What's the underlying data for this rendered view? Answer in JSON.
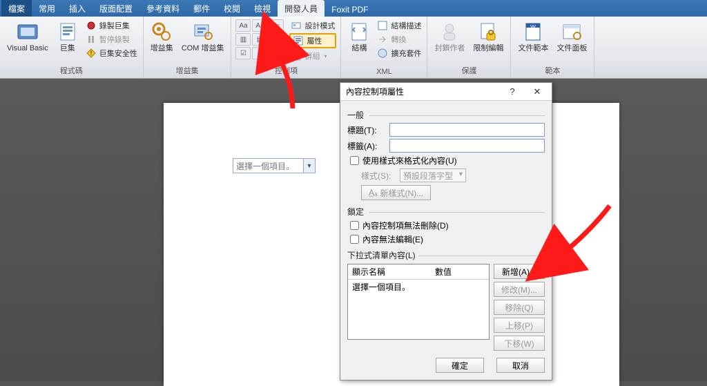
{
  "tabs": {
    "file": "檔案",
    "home": "常用",
    "insert": "插入",
    "layout": "版面配置",
    "references": "參考資料",
    "mailings": "郵件",
    "review": "校閱",
    "view": "檢視",
    "developer": "開發人員",
    "foxit": "Foxit PDF"
  },
  "ribbon": {
    "code_group": {
      "vb": "Visual Basic",
      "macros": "巨集",
      "record": "錄製巨集",
      "pause": "暫停錄製",
      "security": "巨集安全性",
      "caption": "程式碼"
    },
    "addins_group": {
      "addins": "增益集",
      "com": "COM 增益集",
      "caption": "增益集"
    },
    "controls_group": {
      "design_mode": "設計模式",
      "properties": "屬性",
      "group": "群組",
      "caption": "控制項"
    },
    "xml_group": {
      "structure": "結構",
      "schema_desc": "結構描述",
      "transform": "轉換",
      "expansion": "擴充套件",
      "caption": "XML"
    },
    "protect_group": {
      "block_author": "封鎖作者",
      "restrict_edit": "限制編輯",
      "caption": "保護"
    },
    "templates_group": {
      "doc_template": "文件範本",
      "doc_panel": "文件面板",
      "caption": "範本"
    }
  },
  "doc_ctrl": {
    "placeholder": "選擇一個項目。"
  },
  "dialog": {
    "title": "內容控制項屬性",
    "help": "?",
    "close": "✕",
    "general": "一般",
    "title_label": "標題(T):",
    "tag_label": "標籤(A):",
    "use_style": "使用樣式來格式化內容(U)",
    "style_label": "樣式(S):",
    "style_value": "預設段落字型",
    "new_style": "新樣式(N)...",
    "lock": "鎖定",
    "cant_delete": "內容控制項無法刪除(D)",
    "cant_edit": "內容無法編輯(E)",
    "dd_label": "下拉式清單內容(L)",
    "col_name": "顯示名稱",
    "col_value": "數值",
    "row1": "選擇一個項目。",
    "add": "新增(A)...",
    "modify": "修改(M)...",
    "remove": "移除(Q)",
    "up": "上移(P)",
    "down": "下移(W)",
    "ok": "確定",
    "cancel": "取消"
  }
}
